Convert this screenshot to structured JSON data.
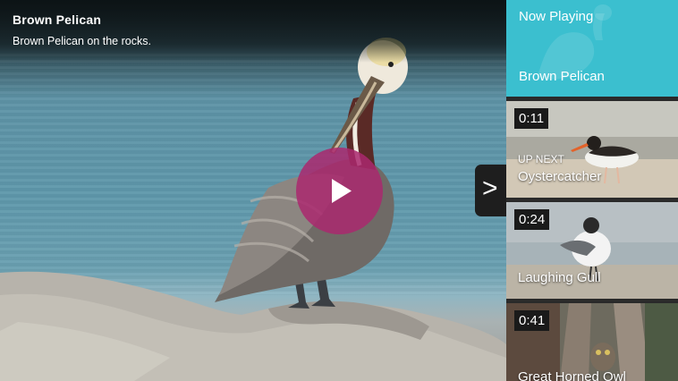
{
  "video": {
    "title": "Brown Pelican",
    "description": "Brown Pelican on the rocks."
  },
  "controls": {
    "play_icon": "play-icon",
    "next_label": ">"
  },
  "playlist": {
    "now_playing_label": "Now Playing",
    "now_playing_title": "Brown Pelican",
    "up_next_label": "UP NEXT",
    "items": [
      {
        "duration": "0:11",
        "title": "Oystercatcher"
      },
      {
        "duration": "0:24",
        "title": "Laughing Gull"
      },
      {
        "duration": "0:41",
        "title": "Great Horned Owl"
      }
    ]
  },
  "colors": {
    "play_button": "#aa286e",
    "now_playing_bg": "#3bbfcf"
  }
}
